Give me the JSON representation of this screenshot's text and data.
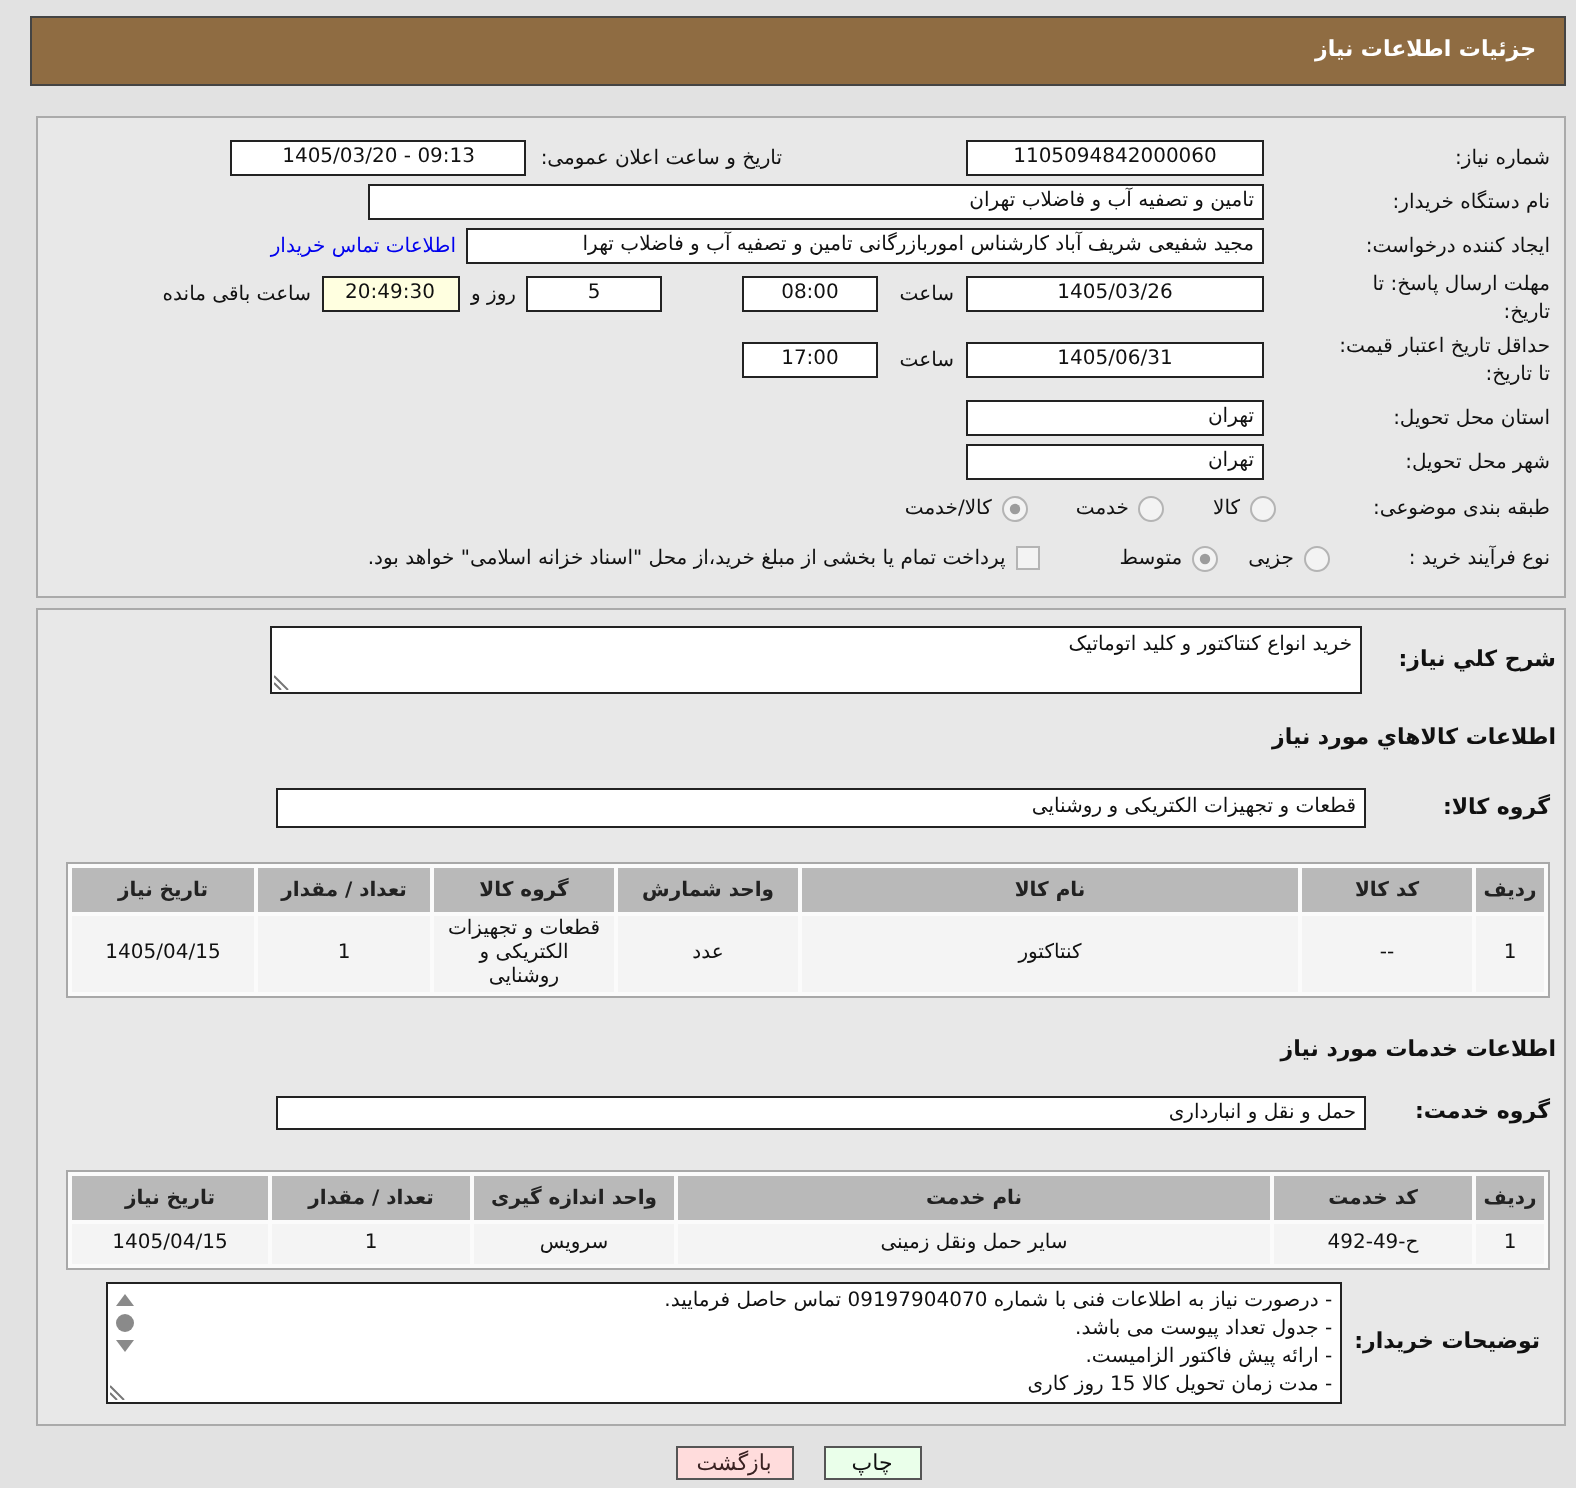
{
  "header": {
    "title": "جزئیات اطلاعات نیاز"
  },
  "need_info": {
    "need_number": {
      "label": "شماره نیاز:",
      "value": "1105094842000060"
    },
    "announce_date": {
      "label": "تاریخ و ساعت اعلان عمومی:",
      "value": "1405/03/20 - 09:13"
    },
    "buyer_org": {
      "label": "نام دستگاه خریدار:",
      "value": "تامین و تصفیه آب و فاضلاب تهران"
    },
    "requester": {
      "label": "ایجاد کننده درخواست:",
      "value": "مجید شفیعی شریف آباد کارشناس اموربازرگانی تامین و تصفیه آب و فاضلاب تهرا",
      "contact_link": "اطلاعات تماس خریدار"
    },
    "reply_deadline": {
      "label": "مهلت ارسال پاسخ: تا تاریخ:",
      "date": "1405/03/26",
      "time_label": "ساعت",
      "time": "08:00",
      "days": "5",
      "days_label": "روز و",
      "remaining": "20:49:30",
      "remaining_label": "ساعت باقی مانده"
    },
    "price_validity": {
      "label": "حداقل تاریخ اعتبار قیمت: تا تاریخ:",
      "date": "1405/06/31",
      "time_label": "ساعت",
      "time": "17:00"
    },
    "delivery_province": {
      "label": "استان محل تحویل:",
      "value": "تهران"
    },
    "delivery_city": {
      "label": "شهر محل تحویل:",
      "value": "تهران"
    },
    "subject_category": {
      "label": "طبقه بندی موضوعی:",
      "options": [
        {
          "label": "کالا",
          "selected": false
        },
        {
          "label": "خدمت",
          "selected": false
        },
        {
          "label": "کالا/خدمت",
          "selected": true
        }
      ]
    },
    "purchase_process": {
      "label": "نوع فرآیند خرید :",
      "options": [
        {
          "label": "جزیی",
          "selected": false
        },
        {
          "label": "متوسط",
          "selected": true
        }
      ],
      "treasury_payment": {
        "label": "پرداخت تمام یا بخشی از مبلغ خرید،از محل \"اسناد خزانه اسلامی\" خواهد بود.",
        "checked": false
      }
    }
  },
  "description": {
    "label": "شرح کلي نياز:",
    "value": "خرید انواع کنتاکتور و کلید اتوماتیک"
  },
  "goods": {
    "title": "اطلاعات كالاهاي مورد نياز",
    "group_label": "گروه کالا:",
    "group_value": "قطعات و تجهیزات الکتریکی و روشنایی",
    "table": {
      "columns": [
        "ردیف",
        "کد کالا",
        "نام کالا",
        "واحد شمارش",
        "گروه کالا",
        "تعداد / مقدار",
        "تاریخ نیاز"
      ],
      "rows": [
        {
          "cells": [
            "1",
            "--",
            "کنتاکتور",
            "عدد",
            "قطعات و تجهیزات الکتریکی و روشنایی",
            "1",
            "1405/04/15"
          ]
        }
      ]
    }
  },
  "services": {
    "title": "اطلاعات خدمات مورد نياز",
    "group_label": "گروه خدمت:",
    "group_value": "حمل و نقل و انبارداری",
    "table": {
      "columns": [
        "ردیف",
        "کد خدمت",
        "نام خدمت",
        "واحد اندازه گیری",
        "تعداد / مقدار",
        "تاریخ نیاز"
      ],
      "rows": [
        {
          "cells": [
            "1",
            "ح-49-492",
            "سایر حمل ونقل زمینی",
            "سرویس",
            "1",
            "1405/04/15"
          ]
        }
      ]
    }
  },
  "buyer_notes": {
    "label": "توضیحات خریدار:",
    "lines": [
      "- درصورت نیاز به اطلاعات فنی با شماره 09197904070 تماس حاصل فرمایید.",
      "- جدول تعداد پیوست می باشد.",
      "- ارائه پیش فاکتور الزامیست.",
      "- مدت زمان تحویل کالا 15 روز کاری"
    ]
  },
  "buttons": [
    {
      "label": "چاپ",
      "kind": "print"
    },
    {
      "label": "بازگشت",
      "kind": "back"
    }
  ]
}
